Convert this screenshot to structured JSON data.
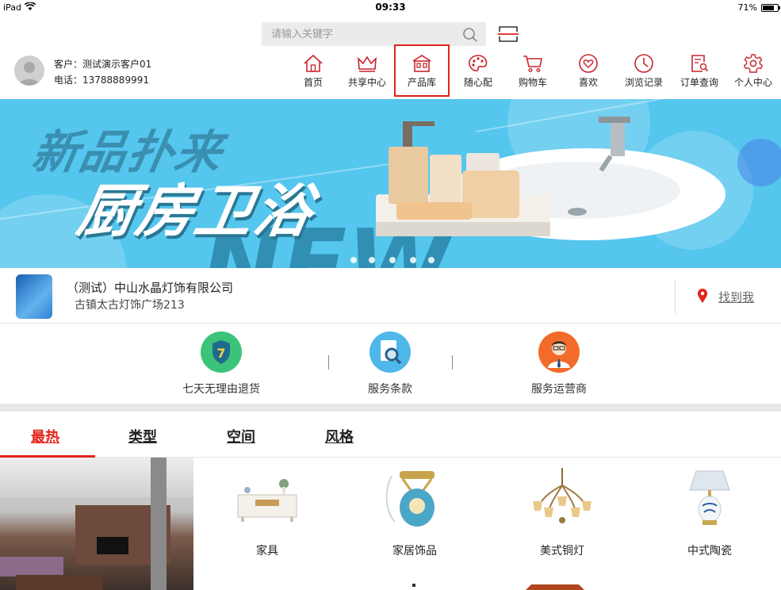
{
  "status_bar": {
    "device": "iPad",
    "time": "09:33",
    "battery": "71%"
  },
  "search": {
    "placeholder": "请输入关键字"
  },
  "user": {
    "customer_label": "客户：测试演示客户01",
    "phone_label": "电话：13788889991"
  },
  "nav": {
    "items": [
      {
        "label": "首页",
        "icon": "home-icon"
      },
      {
        "label": "共享中心",
        "icon": "crown-icon"
      },
      {
        "label": "产品库",
        "icon": "store-icon"
      },
      {
        "label": "随心配",
        "icon": "palette-icon"
      },
      {
        "label": "购物车",
        "icon": "cart-icon"
      },
      {
        "label": "喜欢",
        "icon": "heart-icon"
      },
      {
        "label": "浏览记录",
        "icon": "clock-icon"
      },
      {
        "label": "订单查询",
        "icon": "order-search-icon"
      },
      {
        "label": "个人中心",
        "icon": "gear-icon"
      }
    ],
    "active_index": 2,
    "accent_color": "#e2231a"
  },
  "banner": {
    "line1": "新品扑来",
    "line2": "厨房卫浴",
    "watermark": "NEW",
    "slide_count": 5,
    "bg_color": "#55c6ee"
  },
  "store": {
    "name": "（测试）中山水晶灯饰有限公司",
    "address": "古镇太古灯饰广场213",
    "find_me": "找到我"
  },
  "services": [
    {
      "label": "七天无理由退货",
      "icon": "shield-7-icon",
      "color": "#3cc37a"
    },
    {
      "label": "服务条款",
      "icon": "document-search-icon",
      "color": "#4fb7ea"
    },
    {
      "label": "服务运营商",
      "icon": "operator-avatar-icon",
      "color": "#f36b2b"
    }
  ],
  "tabs": [
    {
      "label": "最热"
    },
    {
      "label": "类型"
    },
    {
      "label": "空间"
    },
    {
      "label": "风格"
    }
  ],
  "categories": [
    {
      "label": "家具"
    },
    {
      "label": "家居饰品"
    },
    {
      "label": "美式铜灯"
    },
    {
      "label": "中式陶瓷"
    }
  ]
}
